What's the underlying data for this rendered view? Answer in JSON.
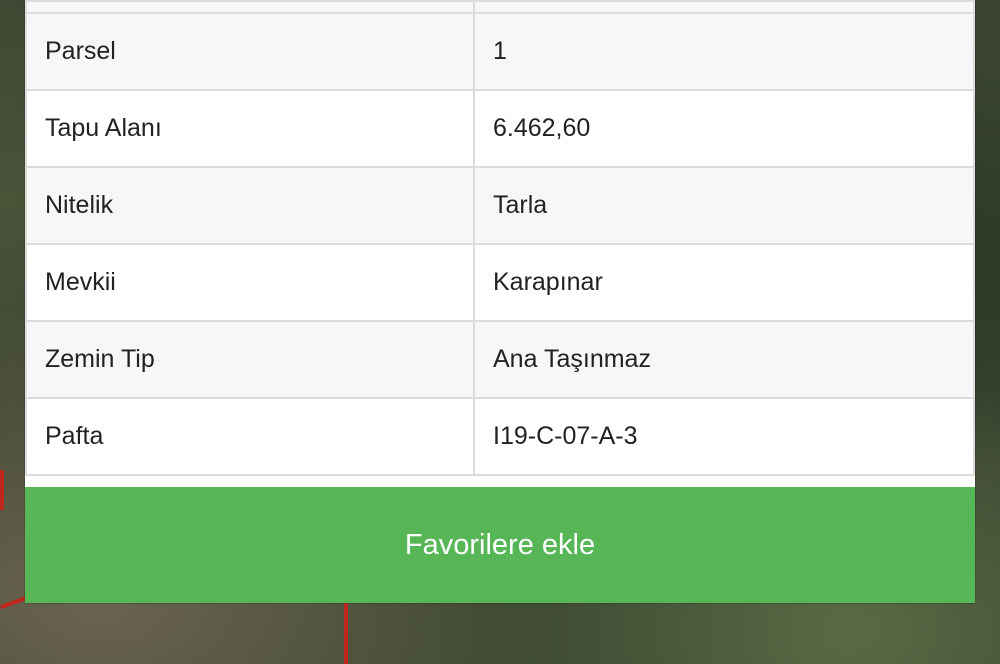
{
  "details": {
    "rows": [
      {
        "label": "",
        "value": ""
      },
      {
        "label": "Parsel",
        "value": "1"
      },
      {
        "label": "Tapu Alanı",
        "value": "6.462,60"
      },
      {
        "label": "Nitelik",
        "value": "Tarla"
      },
      {
        "label": "Mevkii",
        "value": "Karapınar"
      },
      {
        "label": "Zemin Tip",
        "value": "Ana Taşınmaz"
      },
      {
        "label": "Pafta",
        "value": "I19-C-07-A-3"
      }
    ]
  },
  "actions": {
    "favorite_label": "Favorilere ekle",
    "favorite_color": "#57b757"
  },
  "background": {
    "type": "satellite-map",
    "road_color": "#c0271c"
  }
}
